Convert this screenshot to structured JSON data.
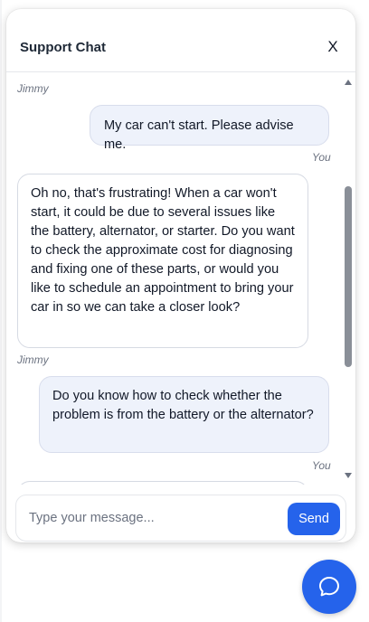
{
  "header": {
    "title": "Support Chat",
    "close_label": "X"
  },
  "messages": [
    {
      "sender": "bot",
      "sender_label": "Jimmy",
      "text": ""
    },
    {
      "sender": "user",
      "sender_label": "You",
      "text": "My car can't start. Please advise me."
    },
    {
      "sender": "bot",
      "sender_label": "Jimmy",
      "text": "Oh no, that's frustrating! When a car won't start, it could be due to several issues like the battery, alternator, or starter. Do you want to check the approximate cost for diagnosing and fixing one of these parts, or would you like to schedule an appointment to bring your car in so we can take a closer look?"
    },
    {
      "sender": "user",
      "sender_label": "You",
      "text": "Do you know how to check whether the problem is from the battery or the alternator?"
    }
  ],
  "composer": {
    "placeholder": "Type your message...",
    "value": "",
    "send_label": "Send"
  },
  "icons": {
    "close": "close-icon",
    "launcher": "chat-bubble-icon",
    "scroll_up": "scroll-up-arrow-icon",
    "scroll_down": "scroll-down-arrow-icon"
  },
  "colors": {
    "accent": "#2563eb",
    "user_bubble": "#eef2fb",
    "bot_bubble": "#ffffff",
    "muted_text": "#6b7280"
  }
}
